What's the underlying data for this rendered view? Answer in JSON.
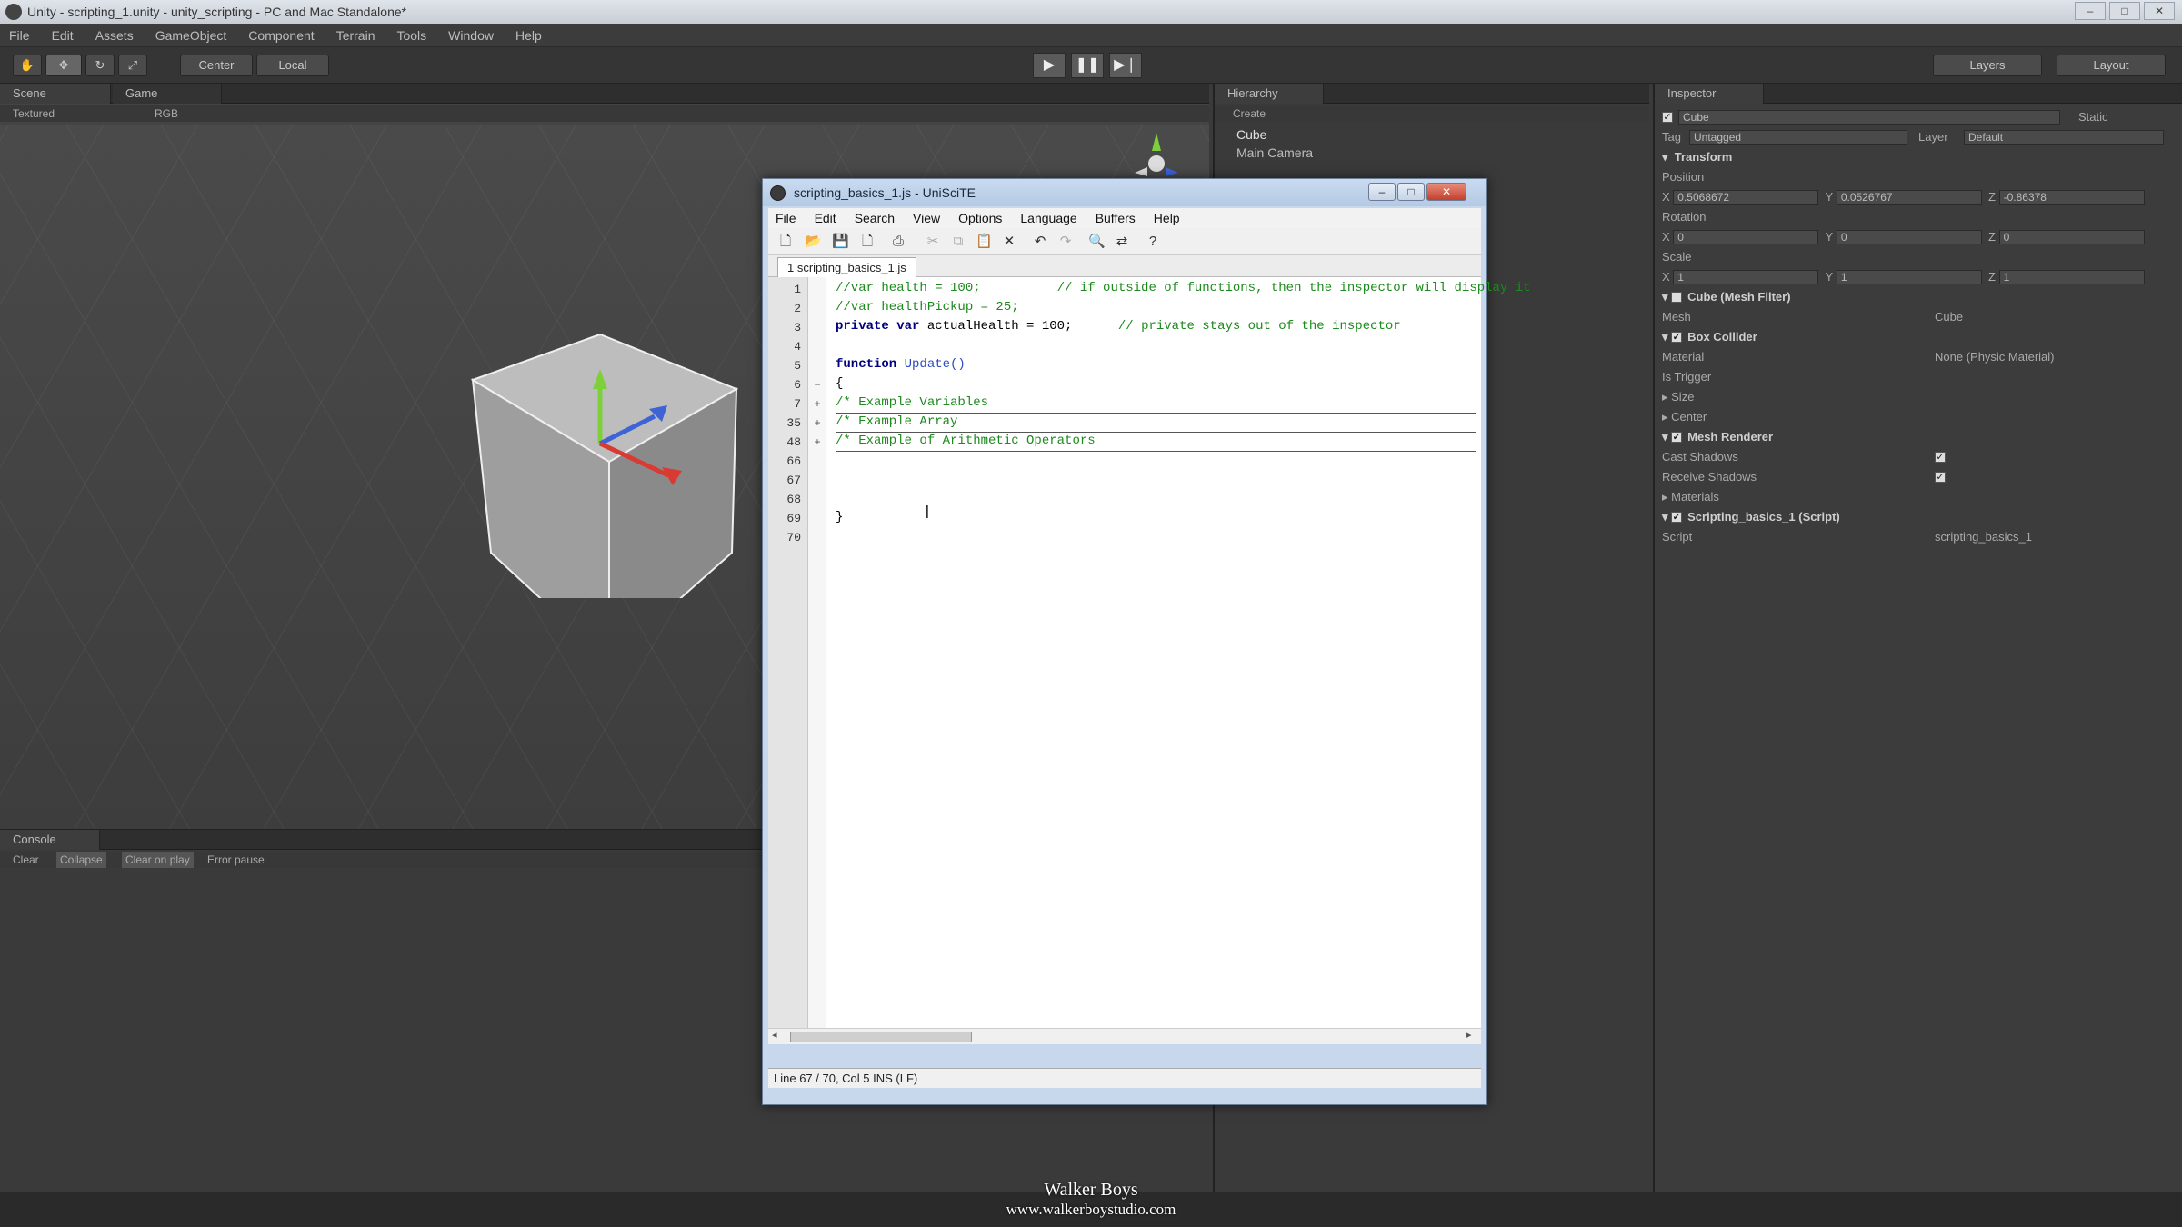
{
  "unity": {
    "window_title": "Unity - scripting_1.unity - unity_scripting - PC and Mac Standalone*",
    "menu": [
      "File",
      "Edit",
      "Assets",
      "GameObject",
      "Component",
      "Terrain",
      "Tools",
      "Window",
      "Help"
    ],
    "toolbar": {
      "pivot": "Center",
      "space": "Local",
      "layers": "Layers",
      "layout": "Layout"
    }
  },
  "scene": {
    "tabs": [
      "Scene",
      "Game"
    ],
    "render_mode": "Textured",
    "color_mode": "RGB"
  },
  "console": {
    "tab": "Console",
    "buttons": [
      "Clear",
      "Collapse",
      "Clear on play",
      "Error pause"
    ]
  },
  "hierarchy": {
    "tab": "Hierarchy",
    "create": "Create",
    "items": [
      "Cube",
      "Main Camera"
    ]
  },
  "inspector": {
    "tab": "Inspector",
    "object_name": "Cube",
    "static": "Static",
    "tag_label": "Tag",
    "tag": "Untagged",
    "layer_label": "Layer",
    "layer": "Default",
    "transform": "Transform",
    "position_label": "Position",
    "position": {
      "x": "0.5068672",
      "y": "0.0526767",
      "z": "-0.86378"
    },
    "rotation_label": "Rotation",
    "rotation": {
      "x": "0",
      "y": "0",
      "z": "0"
    },
    "scale_label": "Scale",
    "scale": {
      "x": "1",
      "y": "1",
      "z": "1"
    },
    "mesh_filter": "Cube (Mesh Filter)",
    "mesh_label": "Mesh",
    "mesh": "Cube",
    "box_collider": "Box Collider",
    "material_label": "Material",
    "material": "None (Physic Material)",
    "is_trigger": "Is Trigger",
    "size": "Size",
    "center": "Center",
    "mesh_renderer": "Mesh Renderer",
    "cast_shadows": "Cast Shadows",
    "receive_shadows": "Receive Shadows",
    "materials": "Materials",
    "script_component": "Scripting_basics_1 (Script)",
    "script_label": "Script",
    "script": "scripting_basics_1"
  },
  "editor": {
    "title": "scripting_basics_1.js - UniSciTE",
    "menu": [
      "File",
      "Edit",
      "Search",
      "View",
      "Options",
      "Language",
      "Buffers",
      "Help"
    ],
    "tab": "1 scripting_basics_1.js",
    "lines": [
      {
        "num": "1",
        "fold": "",
        "text": "//var health = 100;          // if outside of functions, then the inspector will display it",
        "style": "cm"
      },
      {
        "num": "2",
        "fold": "",
        "text": "//var healthPickup = 25;",
        "style": "cm"
      },
      {
        "num": "3",
        "fold": "",
        "kw": "private var",
        "text": " actualHealth = 100;",
        "comment": "      // private stays out of the inspector",
        "style": "mixed"
      },
      {
        "num": "4",
        "fold": "",
        "text": "",
        "style": ""
      },
      {
        "num": "5",
        "fold": "",
        "kw": "function",
        "text": " Update()",
        "style": "func"
      },
      {
        "num": "6",
        "fold": "−",
        "text": "{",
        "style": ""
      },
      {
        "num": "7",
        "fold": "+",
        "text": "/* Example Variables",
        "style": "cm"
      },
      {
        "num": "35",
        "fold": "+",
        "text": "/* Example Array",
        "style": "cm"
      },
      {
        "num": "48",
        "fold": "+",
        "text": "/* Example of Arithmetic Operators",
        "style": "cm"
      },
      {
        "num": "66",
        "fold": "",
        "text": "",
        "style": ""
      },
      {
        "num": "67",
        "fold": "",
        "text": "",
        "style": ""
      },
      {
        "num": "68",
        "fold": "",
        "text": "",
        "style": ""
      },
      {
        "num": "69",
        "fold": "",
        "text": "}",
        "style": ""
      },
      {
        "num": "70",
        "fold": "",
        "text": "",
        "style": ""
      }
    ],
    "status": "Line 67 / 70, Col 5 INS (LF)"
  },
  "watermark": {
    "name": "Walker Boys",
    "url": "www.walkerboystudio.com"
  }
}
